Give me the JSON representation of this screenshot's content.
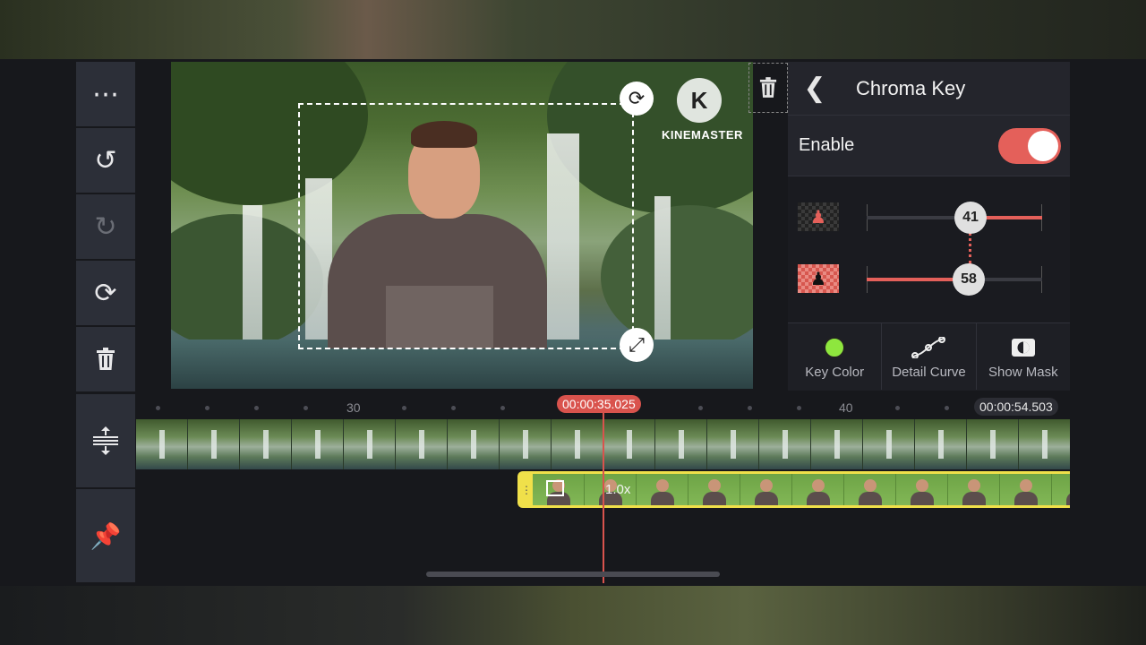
{
  "toolbar": {
    "more_icon": "more-horizontal-icon",
    "undo_icon": "undo-icon",
    "redo_icon": "redo-icon",
    "restart_icon": "restart-icon",
    "delete_icon": "trash-icon"
  },
  "preview": {
    "logo_letter": "K",
    "logo_text": "KINEMASTER"
  },
  "chroma_panel": {
    "title": "Chroma Key",
    "enable_label": "Enable",
    "enabled": true,
    "slider_top_value": "41",
    "slider_bottom_value": "58",
    "buttons": [
      {
        "label": "Key Color",
        "icon": "color-dot-icon"
      },
      {
        "label": "Detail Curve",
        "icon": "curve-icon"
      },
      {
        "label": "Show Mask",
        "icon": "mask-icon"
      }
    ],
    "accent_color": "#e4605a",
    "key_color": "#8ee63e"
  },
  "timeline": {
    "current_time": "00:00:35.025",
    "end_time": "00:00:54.503",
    "ruler_labels": [
      "30",
      "40"
    ],
    "overlay_speed": "1.0x"
  }
}
